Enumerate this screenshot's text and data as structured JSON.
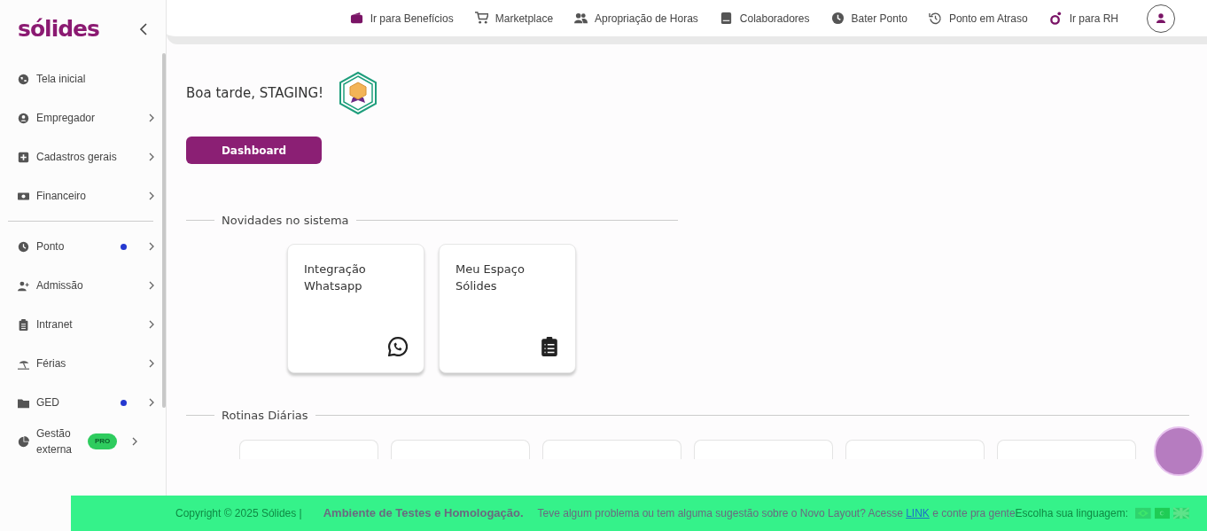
{
  "brand": {
    "logo": "sólides"
  },
  "sidebar": {
    "groups": [
      [
        {
          "label": "Tela inicial",
          "has_submenu": false,
          "notification": false
        },
        {
          "label": "Empregador",
          "has_submenu": true,
          "notification": false
        },
        {
          "label": "Cadastros gerais",
          "has_submenu": true,
          "notification": false
        },
        {
          "label": "Financeiro",
          "has_submenu": true,
          "notification": false
        }
      ],
      [
        {
          "label": "Ponto",
          "has_submenu": true,
          "notification": true
        },
        {
          "label": "Admissão",
          "has_submenu": true,
          "notification": false
        },
        {
          "label": "Intranet",
          "has_submenu": true,
          "notification": false
        },
        {
          "label": "Férias",
          "has_submenu": true,
          "notification": false
        },
        {
          "label": "GED",
          "has_submenu": true,
          "notification": true
        },
        {
          "label": "Gestão externa",
          "has_submenu": true,
          "notification": false,
          "badge": "PRO"
        }
      ]
    ]
  },
  "topnav": [
    {
      "label": "Ir para Benefícios"
    },
    {
      "label": "Marketplace"
    },
    {
      "label": "Apropriação de Horas"
    },
    {
      "label": "Colaboradores"
    },
    {
      "label": "Bater Ponto"
    },
    {
      "label": "Ponto em Atraso"
    },
    {
      "label": "Ir para RH"
    }
  ],
  "greeting": "Boa tarde, STAGING!",
  "dashboard_button": "Dashboard",
  "sections": [
    {
      "title": "Novidades no sistema",
      "cards": [
        {
          "title": "Integração Whatsapp"
        },
        {
          "title": "Meu Espaço Sólides"
        }
      ]
    },
    {
      "title": "Rotinas Diárias"
    }
  ],
  "banner": {
    "copyright": "Copyright © 2025 Sólides |",
    "title": "Ambiente de Testes e Homologação.",
    "message_before": "Teve algum problema ou tem alguma sugestão sobre o Novo Layout? Acesse",
    "link": "LINK",
    "message_after": "e conte pra gente",
    "language_label": "Escolha sua linguagem:"
  }
}
